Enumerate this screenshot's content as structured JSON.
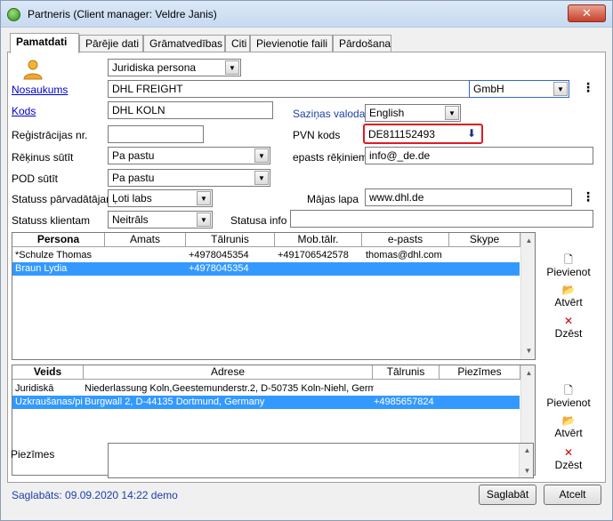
{
  "window": {
    "title": "Partneris (Client manager: Veldre Janis)",
    "close_label": "✕"
  },
  "tabs": [
    {
      "label": "Pamatdati"
    },
    {
      "label": "Pārējie dati"
    },
    {
      "label": "Grāmatvedības"
    },
    {
      "label": "Citi"
    },
    {
      "label": "Pievienotie faili"
    },
    {
      "label": "Pārdošana"
    }
  ],
  "form": {
    "entity_type": "Juridiska persona",
    "name_label": "Nosaukums",
    "name_value": "DHL FREIGHT",
    "legal_form": "GmbH",
    "code_label": "Kods",
    "code_value": "DHL KOLN",
    "comm_lang_label": "Saziņas valoda",
    "comm_lang_value": "English",
    "reg_label": "Reģistrācijas nr.",
    "reg_value": "",
    "vat_label": "PVN kods",
    "vat_value": "DE811152493",
    "invoice_send_label": "Rēķinus sūtīt",
    "invoice_send_value": "Pa pastu",
    "email_invoice_label": "epasts rēķiniem",
    "email_invoice_value": "info@_de.de",
    "pod_label": "POD sūtīt",
    "pod_value": "Pa pastu",
    "status_seller_label": "Statuss pārvadātājam",
    "status_seller_value": "Ļoti labs",
    "homepage_label": "Mājas lapa",
    "homepage_value": "www.dhl.de",
    "status_client_label": "Statuss klientam",
    "status_client_value": "Neitrāls",
    "status_info_label": "Statusa info",
    "status_info_value": ""
  },
  "persons": {
    "columns": [
      "Persona",
      "Amats",
      "Tālrunis",
      "Mob.tālr.",
      "e-pasts",
      "Skype"
    ],
    "rows": [
      [
        "*Schulze Thomas",
        "",
        "+4978045354",
        "+491706542578",
        "thomas@dhl.com",
        ""
      ],
      [
        "Braun Lydia",
        "",
        "+4978045354",
        "",
        "",
        ""
      ]
    ],
    "selected_row": 1
  },
  "addresses": {
    "columns": [
      "Veids",
      "Adrese",
      "Tālrunis",
      "Piezīmes"
    ],
    "rows": [
      [
        "Juridiskā",
        "Niederlassung Koln,Geestemunderstr.2, D-50735 Koln-Niehl, Germar",
        "",
        ""
      ],
      [
        "Uzkraušanas/pi",
        "Burgwall 2, D-44135 Dortmund, Germany",
        "+4985657824",
        ""
      ]
    ],
    "selected_row": 1
  },
  "side_actions": {
    "add": "Pievienot",
    "open": "Atvērt",
    "delete": "Dzēst"
  },
  "notes_label": "Piezīmes",
  "notes_value": "",
  "footer": {
    "status": "Saglabāts: 09.09.2020 14:22 demo",
    "save": "Saglabāt",
    "cancel": "Atcelt"
  },
  "colors": {
    "selection": "#3399ff",
    "highlight_border": "#e01b24",
    "link": "#0000c8"
  }
}
